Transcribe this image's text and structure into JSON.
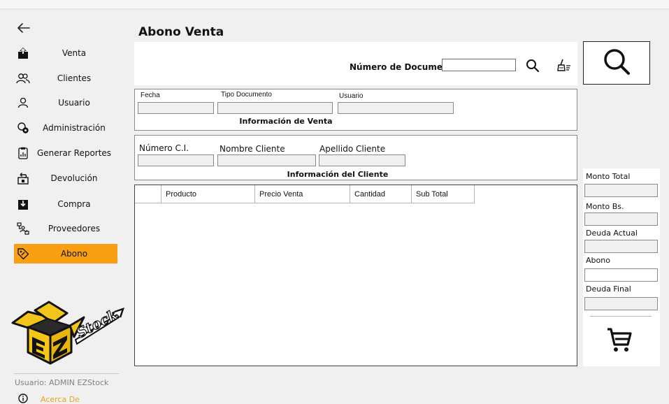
{
  "sidebar": {
    "items": [
      {
        "label": "Venta",
        "icon": "upload-icon"
      },
      {
        "label": "Clientes",
        "icon": "users-icon"
      },
      {
        "label": "Usuario",
        "icon": "user-icon"
      },
      {
        "label": "Administración",
        "icon": "admin-gear-icon"
      },
      {
        "label": "Generar Reportes",
        "icon": "report-icon"
      },
      {
        "label": "Devolución",
        "icon": "return-icon"
      },
      {
        "label": "Compra",
        "icon": "download-icon"
      },
      {
        "label": "Proveedores",
        "icon": "suppliers-icon"
      },
      {
        "label": "Abono",
        "icon": "tag-icon",
        "active": true
      }
    ],
    "logo_text": "EZ Stock",
    "user_line": "Usuario: ADMIN EZStock",
    "about_label": "Acerca De"
  },
  "main": {
    "title": "Abono Venta",
    "document_label": "Número de Documento",
    "document_value": "",
    "venta": {
      "title": "Información de Venta",
      "fields": [
        "Fecha",
        "Tipo Documento",
        "Usuario"
      ]
    },
    "cliente": {
      "title": "Información del Cliente",
      "fields": [
        "Número C.I.",
        "Nombre Cliente",
        "Apellido Cliente"
      ]
    },
    "table": {
      "columns": [
        "",
        "Producto",
        "Precio Venta",
        "Cantidad",
        "Sub Total"
      ]
    },
    "summary": {
      "monto_total": "Monto Total",
      "monto_bs": "Monto Bs.",
      "deuda_actual": "Deuda Actual",
      "abono": "Abono",
      "deuda_final": "Deuda Final"
    }
  },
  "colors": {
    "accent": "#f8a011",
    "about_link": "#f0a020"
  }
}
